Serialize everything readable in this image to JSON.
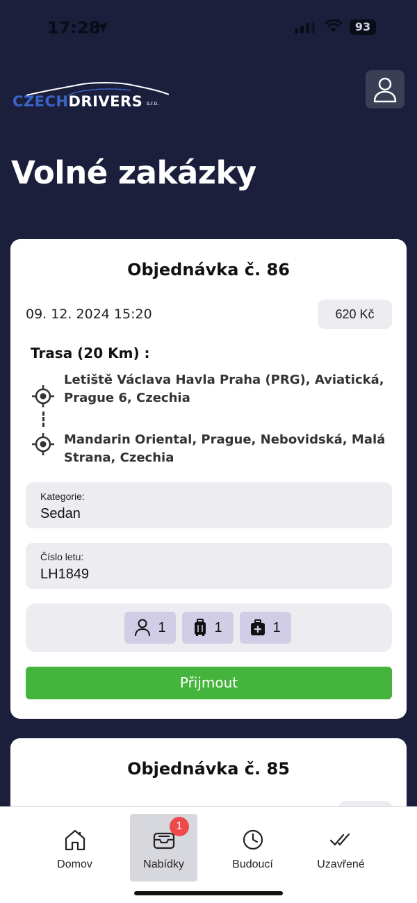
{
  "status_bar": {
    "time": "17:28",
    "battery": "93"
  },
  "header": {
    "logo_czech": "CZECH",
    "logo_drivers": "DRIVERS",
    "logo_sro": "s.r.o.",
    "page_title": "Volné zakázky"
  },
  "orders": [
    {
      "title": "Objednávka č. 86",
      "datetime": "09. 12. 2024 15:20",
      "price": "620 Kč",
      "route_title": "Trasa (20 Km) :",
      "route_from": "Letiště Václava Havla Praha (PRG), Aviatická, Prague 6, Czechia",
      "route_to": "Mandarin Oriental, Prague, Nebovidská, Malá Strana, Czechia",
      "category_label": "Kategorie:",
      "category_value": "Sedan",
      "flight_label": "Číslo letu:",
      "flight_value": "LH1849",
      "passengers": "1",
      "luggage": "1",
      "handbags": "1",
      "accept_label": "Přijmout"
    },
    {
      "title": "Objednávka č. 85"
    }
  ],
  "bottom_nav": {
    "items": [
      {
        "label": "Domov",
        "icon": "home-icon"
      },
      {
        "label": "Nabídky",
        "icon": "inbox-icon",
        "badge": "1",
        "active": true
      },
      {
        "label": "Budoucí",
        "icon": "clock-icon"
      },
      {
        "label": "Uzavřené",
        "icon": "double-check-icon"
      }
    ]
  },
  "colors": {
    "background": "#1b1f3b",
    "accept_green": "#44b43c",
    "chip_purple": "#d2cde6",
    "badge_red": "#ef4a4a",
    "logo_blue": "#3a63c7"
  }
}
